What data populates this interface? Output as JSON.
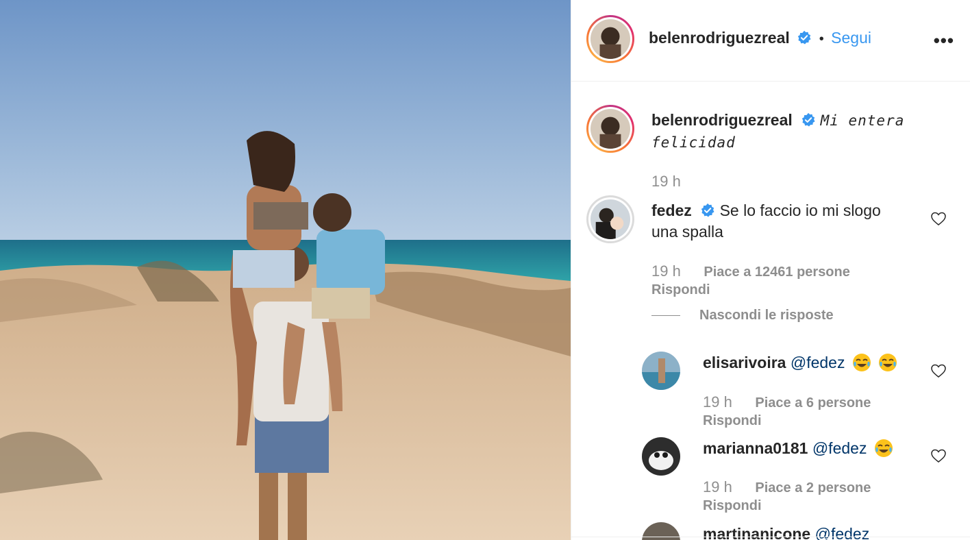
{
  "post": {
    "author": "belenrodriguezreal",
    "follow_label": "Segui",
    "separator": "•",
    "more_label": "•••"
  },
  "caption": {
    "author": "belenrodriguezreal",
    "text_line1": "Mi entera",
    "text_line2": "felicidad",
    "time": "19 h"
  },
  "comments": [
    {
      "author": "fedez",
      "text_line1": "Se lo faccio io mi slogo",
      "text_line2": "una spalla",
      "time": "19 h",
      "likes": "Piace a 12461 persone",
      "reply_label": "Rispondi",
      "hide_replies_label": "Nascondi le risposte",
      "replies": [
        {
          "author": "elisarivoira",
          "mention": "@fedez",
          "time": "19 h",
          "likes": "Piace a 6 persone",
          "reply_label": "Rispondi",
          "emoji_count": 2
        },
        {
          "author": "marianna0181",
          "mention": "@fedez",
          "time": "19 h",
          "likes": "Piace a 2 persone",
          "reply_label": "Rispondi",
          "emoji_count": 1
        },
        {
          "author": "martinanicone",
          "mention": "@fedez"
        }
      ]
    }
  ],
  "icons": {
    "verified": "verified-badge-icon",
    "heart": "heart-outline-icon",
    "emoji": "tears-of-joy-emoji-icon",
    "more": "more-options-icon"
  },
  "colors": {
    "link_blue": "#3897f0",
    "verified_blue": "#3897f0",
    "meta_gray": "#8e8e8e",
    "text": "#262626",
    "mention": "#003569"
  }
}
